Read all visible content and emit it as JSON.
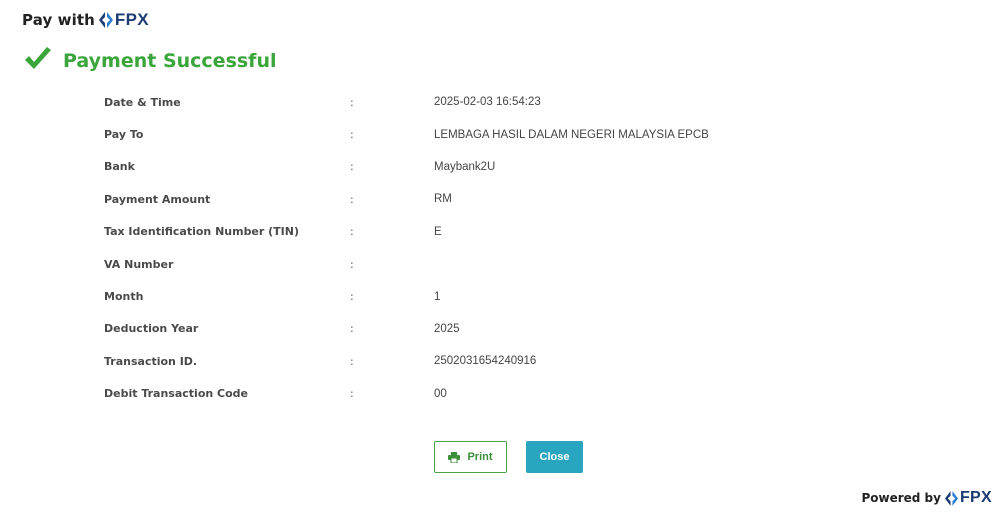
{
  "header": {
    "pay_with": "Pay with",
    "logo_text": "FPX"
  },
  "status": {
    "title": "Payment Successful"
  },
  "details": [
    {
      "label": "Date & Time",
      "sep": ":",
      "value": "2025-02-03 16:54:23"
    },
    {
      "label": "Pay To",
      "sep": ":",
      "value": "LEMBAGA HASIL DALAM NEGERI MALAYSIA EPCB"
    },
    {
      "label": "Bank",
      "sep": ":",
      "value": "Maybank2U"
    },
    {
      "label": "Payment Amount",
      "sep": ":",
      "value": "RM"
    },
    {
      "label": "Tax Identification Number (TIN)",
      "sep": ":",
      "value": "E"
    },
    {
      "label": "VA Number",
      "sep": ":",
      "value": ""
    },
    {
      "label": "Month",
      "sep": ":",
      "value": "1"
    },
    {
      "label": "Deduction Year",
      "sep": ":",
      "value": "2025"
    },
    {
      "label": "Transaction ID.",
      "sep": ":",
      "value": "2502031654240916"
    },
    {
      "label": "Debit Transaction Code",
      "sep": ":",
      "value": "00"
    }
  ],
  "actions": {
    "print_label": "Print",
    "close_label": "Close"
  },
  "footer": {
    "powered_by": "Powered by",
    "logo_text": "FPX"
  },
  "colors": {
    "success": "#3aa53a",
    "brand_navy": "#1c3b73",
    "brand_blue": "#2a7fd4",
    "close_button": "#2aa5bf"
  },
  "icons": {
    "status": "checkmark-icon",
    "print": "printer-icon",
    "logo": "fpx-logo-icon"
  }
}
